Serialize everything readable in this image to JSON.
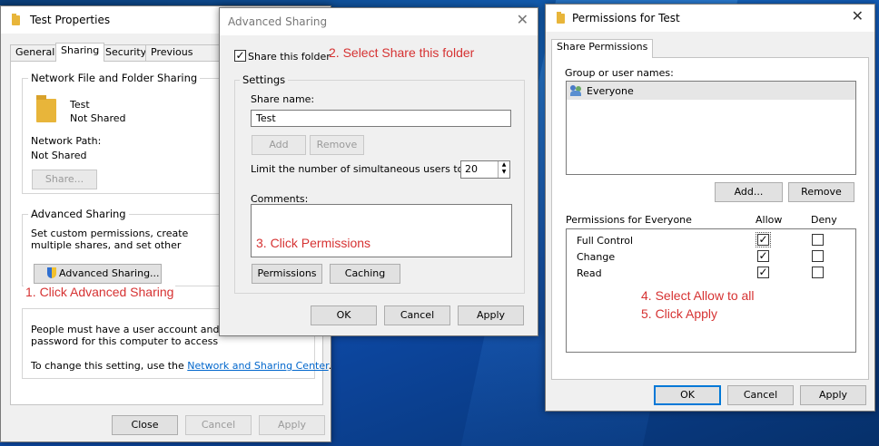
{
  "test_properties": {
    "title": "Test Properties",
    "tabs": [
      "General",
      "Sharing",
      "Security",
      "Previous Versions"
    ],
    "network_group_title": "Network File and Folder Sharing",
    "folder_name": "Test",
    "share_state": "Not Shared",
    "network_path_label": "Network Path:",
    "network_path_value": "Not Shared",
    "share_button": "Share...",
    "advanced_group_title": "Advanced Sharing",
    "advanced_desc": "Set custom permissions, create multiple shares, and set other advanced sharing options.",
    "advanced_button": "Advanced Sharing...",
    "password_desc": "People must have a user account and password for this computer to access shared folders.",
    "change_setting_prefix": "To change this setting, use the",
    "network_center_link": "Network and Sharing Center",
    "buttons": {
      "close": "Close",
      "cancel": "Cancel",
      "apply": "Apply"
    }
  },
  "advanced_sharing": {
    "title": "Advanced Sharing",
    "share_this_folder": "Share this folder",
    "settings_group_title": "Settings",
    "share_name_label": "Share name:",
    "share_name_value": "Test",
    "add_button": "Add",
    "remove_button": "Remove",
    "limit_label": "Limit the number of simultaneous users to:",
    "limit_value": "20",
    "comments_label": "Comments:",
    "permissions_button": "Permissions",
    "caching_button": "Caching",
    "buttons": {
      "ok": "OK",
      "cancel": "Cancel",
      "apply": "Apply"
    }
  },
  "permissions": {
    "title": "Permissions for Test",
    "tab": "Share Permissions",
    "group_label": "Group or user names:",
    "users": [
      "Everyone"
    ],
    "add_button": "Add...",
    "remove_button": "Remove",
    "perm_header": "Permissions for Everyone",
    "allow_header": "Allow",
    "deny_header": "Deny",
    "rows": [
      {
        "name": "Full Control",
        "allow": true,
        "deny": false
      },
      {
        "name": "Change",
        "allow": true,
        "deny": false
      },
      {
        "name": "Read",
        "allow": true,
        "deny": false
      }
    ],
    "buttons": {
      "ok": "OK",
      "cancel": "Cancel",
      "apply": "Apply"
    }
  },
  "annotations": {
    "step1": "1. Click Advanced Sharing",
    "step2": "2. Select Share this folder",
    "step3": "3. Click Permissions",
    "step4": "4. Select Allow to all",
    "step5": "5. Click Apply"
  },
  "colors": {
    "annotation": "#d63232",
    "accent": "#0078d7",
    "folder": "#e8b53a"
  }
}
